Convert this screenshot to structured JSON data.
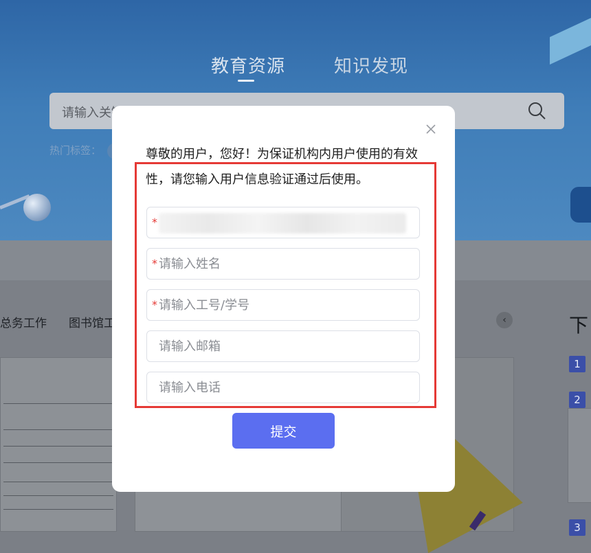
{
  "background": {
    "tabs": [
      "教育资源",
      "知识发现"
    ],
    "search_placeholder": "请输入关键词",
    "hot_tags_label": "热门标签：",
    "categories": [
      "总务工作",
      "图书馆工"
    ],
    "right_title": "下",
    "ranks": [
      "1",
      "2",
      "3"
    ]
  },
  "modal": {
    "notice": "尊敬的用户，您好！为保证机构内用户使用的有效性，请您输入用户信息验证通过后使用。",
    "fields": [
      {
        "required": true,
        "placeholder": "",
        "value": ""
      },
      {
        "required": true,
        "placeholder": "请输入姓名",
        "value": ""
      },
      {
        "required": true,
        "placeholder": "请输入工号/学号",
        "value": ""
      },
      {
        "required": false,
        "placeholder": "请输入邮箱",
        "value": ""
      },
      {
        "required": false,
        "placeholder": "请输入电话",
        "value": ""
      }
    ],
    "required_mark": "*",
    "submit_label": "提交"
  },
  "colors": {
    "accent": "#5b6ef0",
    "highlight_border": "#e53935",
    "required": "#e53935"
  },
  "icons": {
    "close": "close-icon",
    "search": "search-icon"
  }
}
